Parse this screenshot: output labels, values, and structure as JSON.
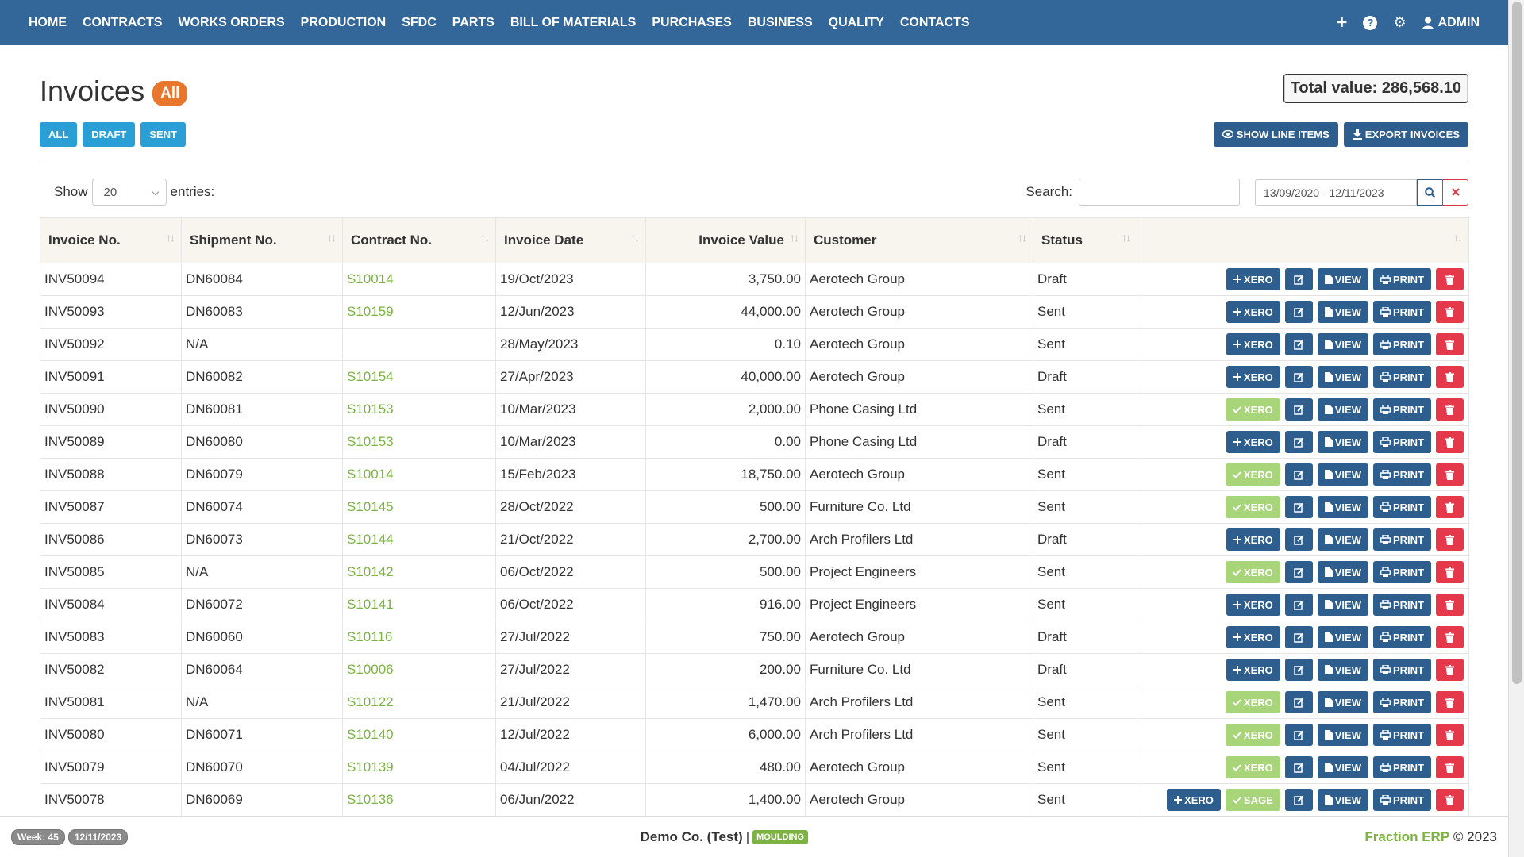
{
  "nav": {
    "items": [
      "HOME",
      "CONTRACTS",
      "WORKS ORDERS",
      "PRODUCTION",
      "SFDC",
      "PARTS",
      "BILL OF MATERIALS",
      "PURCHASES",
      "BUSINESS",
      "QUALITY",
      "CONTACTS"
    ],
    "plus_icon": "+",
    "help_icon": "?",
    "gear_icon": "⚙",
    "user_icon": "👤",
    "admin_label": "ADMIN"
  },
  "header": {
    "title": "Invoices",
    "badge": "All",
    "total": "Total value: 286,568.10"
  },
  "filters": {
    "all": "ALL",
    "draft": "DRAFT",
    "sent": "SENT",
    "show_line_items": "SHOW LINE ITEMS",
    "export_invoices": "EXPORT INVOICES"
  },
  "controls": {
    "show": "Show",
    "page_size": "20",
    "entries": "entries:",
    "search_label": "Search:",
    "date_range": "13/09/2020 - 12/11/2023"
  },
  "table": {
    "columns": [
      "Invoice No.",
      "Shipment No.",
      "Contract No.",
      "Invoice Date",
      "Invoice Value",
      "Customer",
      "Status",
      ""
    ],
    "rows": [
      {
        "inv": "INV50094",
        "ship": "DN60084",
        "contract": "S10014",
        "date": "19/Oct/2023",
        "value": "3,750.00",
        "customer": "Aerotech Group",
        "status": "Draft",
        "xero": "pending"
      },
      {
        "inv": "INV50093",
        "ship": "DN60083",
        "contract": "S10159",
        "date": "12/Jun/2023",
        "value": "44,000.00",
        "customer": "Aerotech Group",
        "status": "Sent",
        "xero": "pending"
      },
      {
        "inv": "INV50092",
        "ship": "N/A",
        "contract": "",
        "date": "28/May/2023",
        "value": "0.10",
        "customer": "Aerotech Group",
        "status": "Sent",
        "xero": "pending"
      },
      {
        "inv": "INV50091",
        "ship": "DN60082",
        "contract": "S10154",
        "date": "27/Apr/2023",
        "value": "40,000.00",
        "customer": "Aerotech Group",
        "status": "Draft",
        "xero": "pending"
      },
      {
        "inv": "INV50090",
        "ship": "DN60081",
        "contract": "S10153",
        "date": "10/Mar/2023",
        "value": "2,000.00",
        "customer": "Phone Casing Ltd",
        "status": "Sent",
        "xero": "done"
      },
      {
        "inv": "INV50089",
        "ship": "DN60080",
        "contract": "S10153",
        "date": "10/Mar/2023",
        "value": "0.00",
        "customer": "Phone Casing Ltd",
        "status": "Draft",
        "xero": "pending"
      },
      {
        "inv": "INV50088",
        "ship": "DN60079",
        "contract": "S10014",
        "date": "15/Feb/2023",
        "value": "18,750.00",
        "customer": "Aerotech Group",
        "status": "Sent",
        "xero": "done"
      },
      {
        "inv": "INV50087",
        "ship": "DN60074",
        "contract": "S10145",
        "date": "28/Oct/2022",
        "value": "500.00",
        "customer": "Furniture Co. Ltd",
        "status": "Sent",
        "xero": "done"
      },
      {
        "inv": "INV50086",
        "ship": "DN60073",
        "contract": "S10144",
        "date": "21/Oct/2022",
        "value": "2,700.00",
        "customer": "Arch Profilers Ltd",
        "status": "Draft",
        "xero": "pending"
      },
      {
        "inv": "INV50085",
        "ship": "N/A",
        "contract": "S10142",
        "date": "06/Oct/2022",
        "value": "500.00",
        "customer": "Project Engineers",
        "status": "Sent",
        "xero": "done"
      },
      {
        "inv": "INV50084",
        "ship": "DN60072",
        "contract": "S10141",
        "date": "06/Oct/2022",
        "value": "916.00",
        "customer": "Project Engineers",
        "status": "Sent",
        "xero": "pending"
      },
      {
        "inv": "INV50083",
        "ship": "DN60060",
        "contract": "S10116",
        "date": "27/Jul/2022",
        "value": "750.00",
        "customer": "Aerotech Group",
        "status": "Draft",
        "xero": "pending"
      },
      {
        "inv": "INV50082",
        "ship": "DN60064",
        "contract": "S10006",
        "date": "27/Jul/2022",
        "value": "200.00",
        "customer": "Furniture Co. Ltd",
        "status": "Draft",
        "xero": "pending"
      },
      {
        "inv": "INV50081",
        "ship": "N/A",
        "contract": "S10122",
        "date": "21/Jul/2022",
        "value": "1,470.00",
        "customer": "Arch Profilers Ltd",
        "status": "Sent",
        "xero": "done"
      },
      {
        "inv": "INV50080",
        "ship": "DN60071",
        "contract": "S10140",
        "date": "12/Jul/2022",
        "value": "6,000.00",
        "customer": "Arch Profilers Ltd",
        "status": "Sent",
        "xero": "done"
      },
      {
        "inv": "INV50079",
        "ship": "DN60070",
        "contract": "S10139",
        "date": "04/Jul/2022",
        "value": "480.00",
        "customer": "Aerotech Group",
        "status": "Sent",
        "xero": "done"
      },
      {
        "inv": "INV50078",
        "ship": "DN60069",
        "contract": "S10136",
        "date": "06/Jun/2022",
        "value": "1,400.00",
        "customer": "Aerotech Group",
        "status": "Sent",
        "xero": "sage"
      }
    ],
    "actions": {
      "xero": "XERO",
      "sage": "SAGE",
      "view": "VIEW",
      "print": "PRINT"
    }
  },
  "footer": {
    "week": "Week: 45",
    "date": "12/11/2023",
    "company": "Demo Co. (Test)",
    "separator": "|",
    "dept": "MOULDING",
    "brand": "Fraction ERP",
    "copyright": "© 2023"
  },
  "colors": {
    "navbar": "#336699",
    "accent_green": "#7cb342",
    "badge_orange": "#e8762d",
    "info_blue": "#2a9fd6",
    "danger": "#e5394b"
  }
}
